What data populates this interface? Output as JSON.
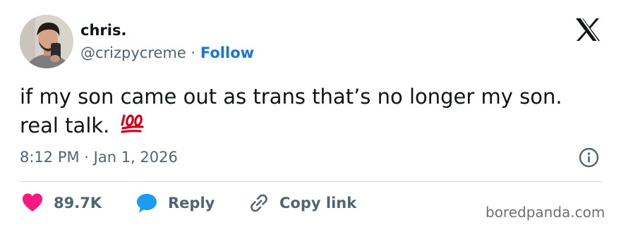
{
  "author": {
    "display_name": "chris.",
    "handle": "@crizpycreme",
    "separator": "·",
    "follow_label": "Follow"
  },
  "tweet": {
    "text": "if my son came out as trans that’s no longer my son. real talk.",
    "emoji_icon": "hundred-points-emoji",
    "timestamp": "8:12 PM · Jan 1, 2026"
  },
  "actions": {
    "like_count": "89.7K",
    "reply_label": "Reply",
    "copy_label": "Copy link"
  },
  "icons": {
    "logo": "x-logo-icon",
    "info": "info-icon",
    "like": "heart-icon",
    "reply": "speech-bubble-icon",
    "copy": "link-icon"
  },
  "colors": {
    "follow": "#1d75d3",
    "heart": "#f91880",
    "reply": "#1d9bf0",
    "muted": "#536471",
    "emoji": "#d0021b"
  },
  "watermark": "boredpanda.com"
}
